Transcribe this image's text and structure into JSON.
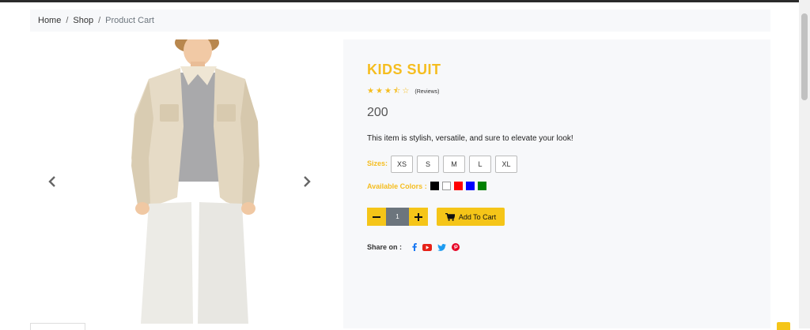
{
  "breadcrumb": {
    "home": "Home",
    "separator": "/",
    "shop": "Shop",
    "current": "Product Cart"
  },
  "product": {
    "title": "KIDS SUIT",
    "rating": 3.5,
    "rating_max": 5,
    "reviews_label": "(Reviews)",
    "price": "200",
    "description": "This item is stylish, versatile, and sure to elevate your look!"
  },
  "sizes": {
    "label": "Sizes:",
    "options": [
      "XS",
      "S",
      "M",
      "L",
      "XL"
    ]
  },
  "colors": {
    "label": "Available Colors :",
    "swatches": [
      "#000000",
      "#ffffff",
      "#ff0000",
      "#0000ff",
      "#008000"
    ]
  },
  "quantity": {
    "value": "1",
    "decrement_icon": "minus-icon",
    "increment_icon": "plus-icon"
  },
  "cart": {
    "label": "Add To Cart",
    "icon": "shopping-cart-icon"
  },
  "share": {
    "label": "Share on :",
    "icons": [
      "facebook-icon",
      "youtube-icon",
      "twitter-icon",
      "pinterest-icon"
    ]
  },
  "theme": {
    "accent": "#f5bd1f",
    "button": "#f5c518",
    "panel": "#f7f8fa"
  },
  "gallery": {
    "prev_icon": "chevron-left-icon",
    "next_icon": "chevron-right-icon"
  }
}
